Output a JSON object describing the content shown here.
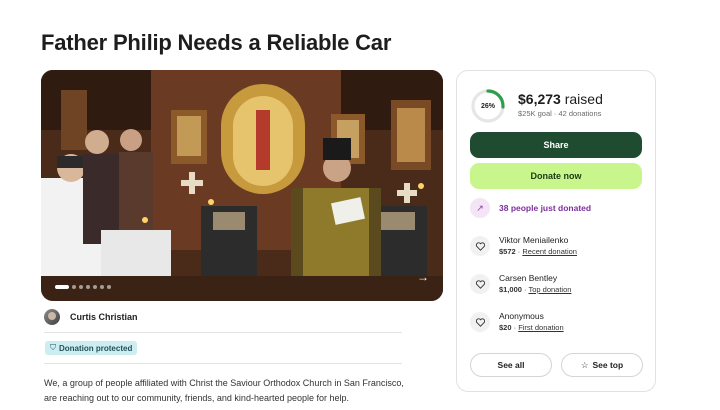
{
  "campaign": {
    "title": "Father Philip Needs a Reliable Car",
    "organizer": "Curtis Christian",
    "protected_label": "Donation protected",
    "story": "We, a group of people affiliated with Christ the Saviour Orthodox Church in San Francisco, are reaching out to our community, friends, and kind-hearted people for help."
  },
  "gallery": {
    "slides": 8,
    "active_slide": 1,
    "next_icon": "arrow-right-icon"
  },
  "summary": {
    "percent_label": "26%",
    "percent": 26,
    "raised": "$6,273",
    "raised_suffix": " raised",
    "goal_line": "$25K goal · 42 donations",
    "share_label": "Share",
    "donate_label": "Donate now",
    "trend_text": "38 people just donated",
    "see_all_label": "See all",
    "see_top_label": "See top",
    "accent_color": "#1f4b30",
    "donate_color": "#c8f58c",
    "trend_color": "#7b2f9c"
  },
  "donations": [
    {
      "name": "Viktor Meniailenko",
      "amount": "$572",
      "tag": "Recent donation"
    },
    {
      "name": "Carsen Bentley",
      "amount": "$1,000",
      "tag": "Top donation"
    },
    {
      "name": "Anonymous",
      "amount": "$20",
      "tag": "First donation"
    }
  ]
}
